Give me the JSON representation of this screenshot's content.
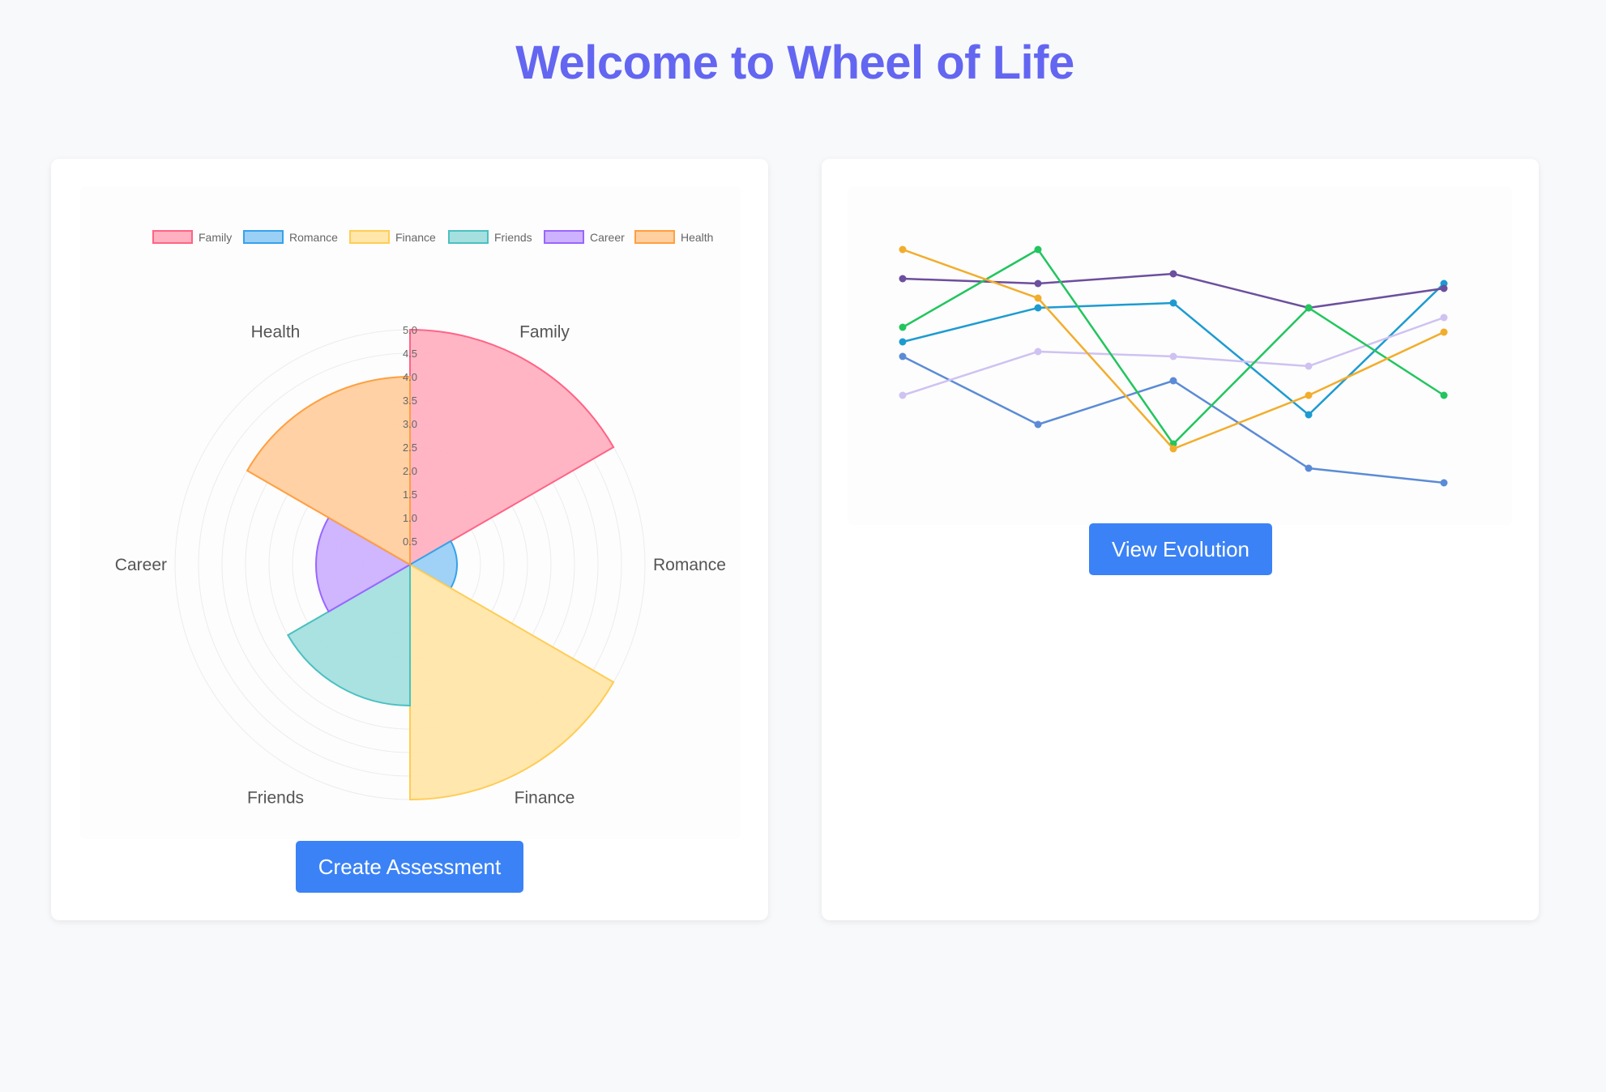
{
  "page": {
    "title": "Welcome to Wheel of Life"
  },
  "buttons": {
    "create_assessment": "Create Assessment",
    "view_evolution": "View Evolution"
  },
  "chart_data": [
    {
      "type": "polarArea",
      "categories": [
        "Family",
        "Romance",
        "Finance",
        "Friends",
        "Career",
        "Health"
      ],
      "values": [
        5.0,
        1.0,
        5.0,
        3.0,
        2.0,
        4.0
      ],
      "rlim": [
        0,
        5
      ],
      "rticks": [
        "0.5",
        "1.0",
        "1.5",
        "2.0",
        "2.5",
        "3.0",
        "3.5",
        "4.0",
        "4.5",
        "5.0"
      ],
      "legend": "top",
      "colors": {
        "fill": [
          "#ffb1c1",
          "#9ad0f5",
          "#ffe6aa",
          "#a5dfdf",
          "#ccb2ff",
          "#ffcf9f"
        ],
        "stroke": [
          "#ff6384",
          "#36a2eb",
          "#ffcd56",
          "#4bc0c0",
          "#9966ff",
          "#ff9f40"
        ]
      }
    },
    {
      "type": "line",
      "x": [
        1,
        2,
        3,
        4,
        5
      ],
      "ylim": [
        0,
        5
      ],
      "axes_visible": false,
      "series": [
        {
          "values": [
            3.1,
            3.8,
            3.9,
            1.6,
            4.3
          ],
          "color": "#1d9bd1"
        },
        {
          "values": [
            4.4,
            4.3,
            4.5,
            3.8,
            4.2
          ],
          "color": "#6c4f9e"
        },
        {
          "values": [
            2.8,
            1.4,
            2.3,
            0.5,
            0.2
          ],
          "color": "#5b8bd6"
        },
        {
          "values": [
            2.0,
            2.9,
            2.8,
            2.6,
            3.6
          ],
          "color": "#cfc2f2"
        },
        {
          "values": [
            3.4,
            5.0,
            1.0,
            3.8,
            2.0
          ],
          "color": "#22c55e"
        },
        {
          "values": [
            5.0,
            4.0,
            0.9,
            2.0,
            3.3
          ],
          "color": "#f2ad2c"
        }
      ]
    }
  ]
}
